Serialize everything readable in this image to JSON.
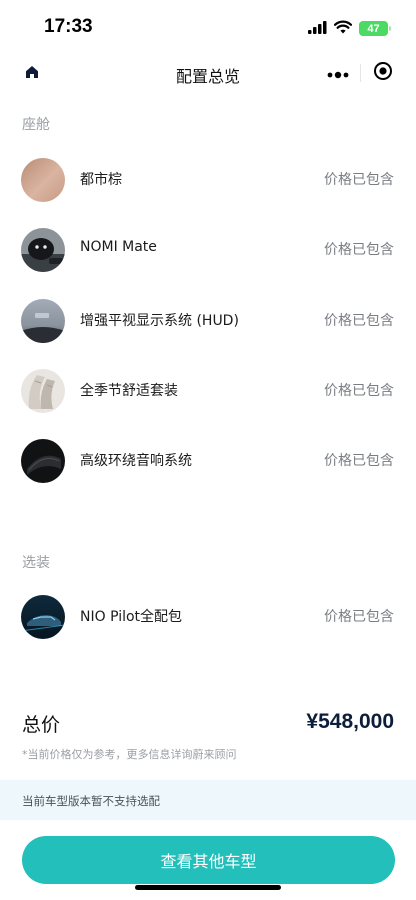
{
  "status_bar": {
    "time": "17:33",
    "battery": "47"
  },
  "nav": {
    "title": "配置总览",
    "home_icon": "home-icon",
    "more_icon": "more-dots-icon",
    "target_icon": "record-target-icon"
  },
  "sections": [
    {
      "label": "座舱",
      "items": [
        {
          "name": "都市棕",
          "price": "价格已包含",
          "thumb": "brown-swatch"
        },
        {
          "name": "NOMI Mate",
          "price": "价格已包含",
          "thumb": "nomi-robot"
        },
        {
          "name": "增强平视显示系统 (HUD)",
          "price": "价格已包含",
          "thumb": "hud-windshield"
        },
        {
          "name": "全季节舒适套装",
          "price": "价格已包含",
          "thumb": "seat"
        },
        {
          "name": "高级环绕音响系统",
          "price": "价格已包含",
          "thumb": "speaker"
        }
      ]
    },
    {
      "label": "选装",
      "items": [
        {
          "name": "NIO Pilot全配包",
          "price": "价格已包含",
          "thumb": "car-pilot"
        }
      ]
    }
  ],
  "total": {
    "label": "总价",
    "value": "¥548,000",
    "disclaimer": "*当前价格仅为参考，更多信息详询蔚来顾问"
  },
  "notice": "当前车型版本暂不支持选配",
  "cta_label": "查看其他车型",
  "colors": {
    "accent": "#23bfba",
    "notice_bg": "#eef7fb",
    "price_text": "#0c1e3a"
  }
}
